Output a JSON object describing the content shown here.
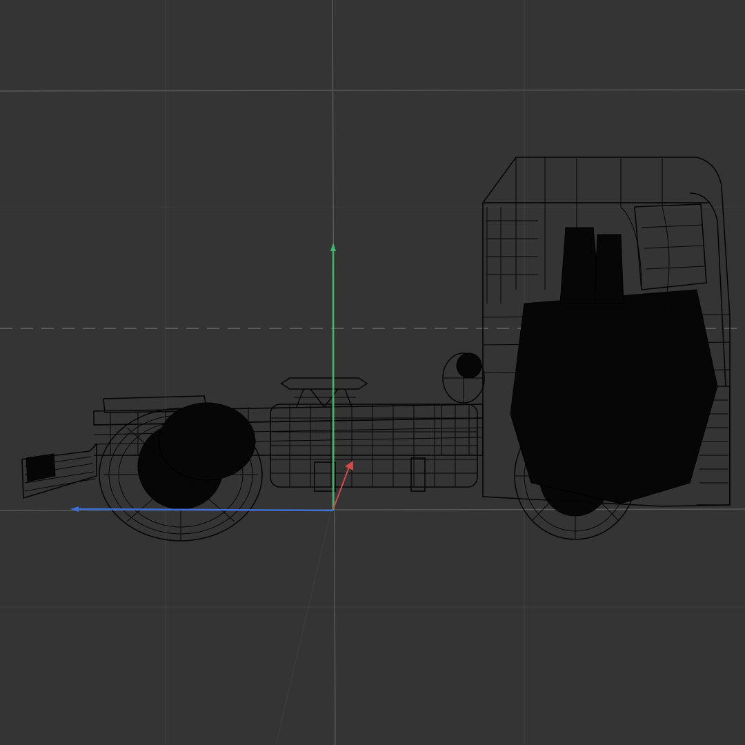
{
  "viewport": {
    "background_color": "#343434",
    "grid_color": "#585858",
    "horizon_color": "#6a6a6a",
    "wireframe_color": "#050505",
    "view": "side-orthographic",
    "render_mode": "wireframe"
  },
  "gizmo": {
    "y_axis_color": "#3fb86a",
    "z_axis_color": "#3d6fd6",
    "x_axis_color": "#d24a4a",
    "icon": "transform-axis-gizmo-icon"
  },
  "model": {
    "icon": "truck-tractor-wireframe-icon"
  }
}
